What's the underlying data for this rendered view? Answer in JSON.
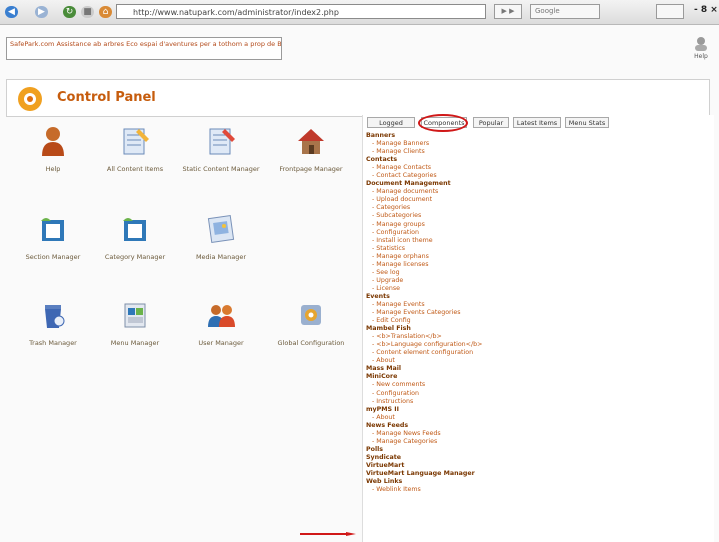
{
  "browser": {
    "url": "http://www.natupark.com/administrator/index2.php",
    "search_label": "Google"
  },
  "site": {
    "message": "SafePark.com Assistance ab arbres Eco espai d'aventures per a tothom a prop de Barcelona. /com_admin",
    "help_top": "Help"
  },
  "header": {
    "title": "Control Panel"
  },
  "icons": [
    {
      "label": "Help",
      "icon": "help-person-icon"
    },
    {
      "label": "All Content Items",
      "icon": "content-items-icon"
    },
    {
      "label": "Static Content Manager",
      "icon": "static-content-icon"
    },
    {
      "label": "Frontpage Manager",
      "icon": "frontpage-house-icon"
    },
    {
      "label": "Section Manager",
      "icon": "section-folder-icon"
    },
    {
      "label": "Category Manager",
      "icon": "category-folder-icon"
    },
    {
      "label": "Media Manager",
      "icon": "media-image-icon"
    },
    {
      "label": "Trash Manager",
      "icon": "trash-bin-icon"
    },
    {
      "label": "Menu Manager",
      "icon": "menu-icon"
    },
    {
      "label": "User Manager",
      "icon": "users-icon"
    },
    {
      "label": "Global Configuration",
      "icon": "config-gear-icon"
    }
  ],
  "tabs": [
    "Logged",
    "Components",
    "Popular",
    "Latest Items",
    "Menu Stats"
  ],
  "components": [
    {
      "name": "Banners",
      "items": [
        "Manage Banners",
        "Manage Clients"
      ]
    },
    {
      "name": "Contacts",
      "items": [
        "Manage Contacts",
        "Contact Categories"
      ]
    },
    {
      "name": "Document Management",
      "items": [
        "Manage documents",
        "Upload document",
        "Categories",
        "Subcategories",
        "Manage groups",
        "Configuration",
        "Install icon theme",
        "Statistics",
        "Manage orphans",
        "Manage licenses",
        "See log",
        "Upgrade",
        "License"
      ]
    },
    {
      "name": "Events",
      "items": [
        "Manage Events",
        "Manage Events Categories",
        "Edit Config"
      ]
    },
    {
      "name": "Mambel Fish",
      "items": [
        "<b>Translation</b>",
        "<b>Language configuration</b>",
        "Content element configuration",
        "About"
      ]
    },
    {
      "name": "Mass Mail",
      "items": []
    },
    {
      "name": "MiniCore",
      "items": [
        "New comments",
        "Configuration",
        "Instructions"
      ]
    },
    {
      "name": "myPMS II",
      "items": [
        "About"
      ]
    },
    {
      "name": "News Feeds",
      "items": [
        "Manage News Feeds",
        "Manage Categories"
      ]
    },
    {
      "name": "Polls",
      "items": []
    },
    {
      "name": "Syndicate",
      "items": []
    },
    {
      "name": "VirtueMart",
      "items": []
    },
    {
      "name": "VirtueMart Language Manager",
      "items": []
    },
    {
      "name": "Web Links",
      "items": [
        "Weblink Items"
      ]
    }
  ],
  "colors": {
    "accent": "#c65c0d",
    "highlight": "#d01818"
  }
}
